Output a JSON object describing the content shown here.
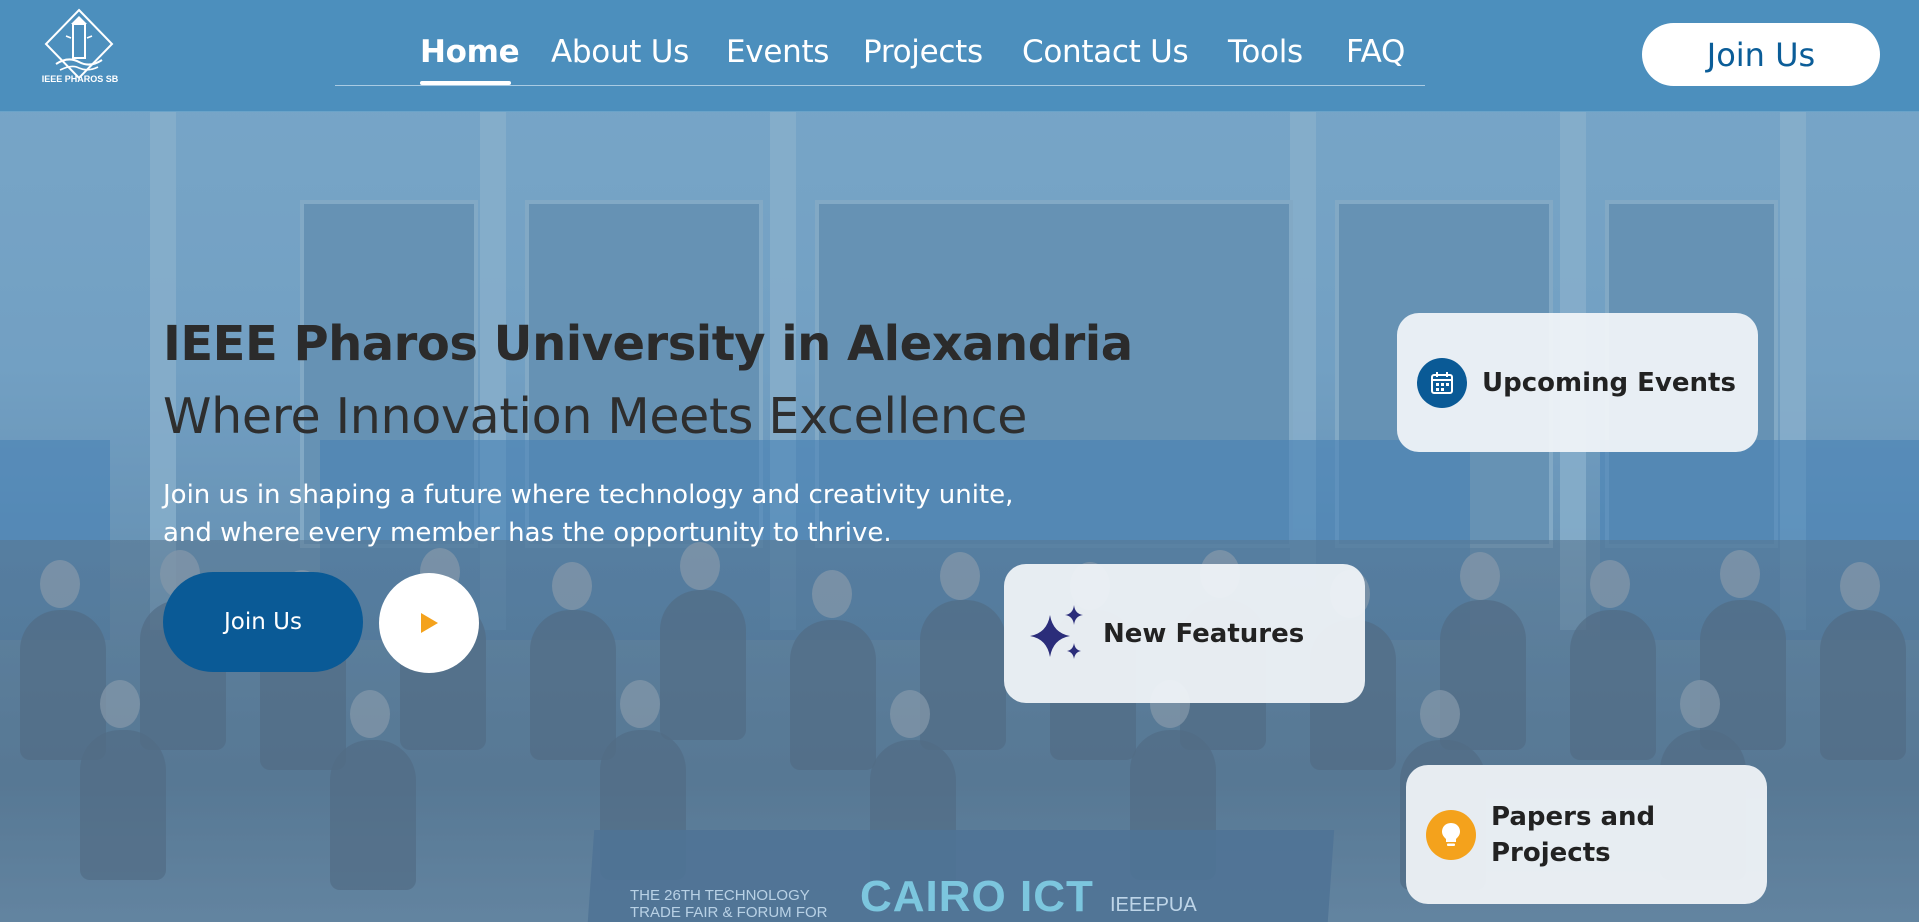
{
  "header": {
    "logo_text": "IEEE PHAROS SB",
    "nav": [
      {
        "label": "Home",
        "active": true
      },
      {
        "label": "About Us",
        "active": false
      },
      {
        "label": "Events",
        "active": false
      },
      {
        "label": "Projects",
        "active": false
      },
      {
        "label": "Contact Us",
        "active": false
      },
      {
        "label": "Tools",
        "active": false
      },
      {
        "label": "FAQ",
        "active": false
      }
    ],
    "join_label": "Join Us"
  },
  "hero": {
    "title": "IEEE Pharos University in Alexandria",
    "subtitle": "Where Innovation Meets Excellence",
    "description_line1": "Join us in shaping a future where technology and creativity unite,",
    "description_line2": "and where every member has the opportunity to thrive.",
    "join_label": "Join Us",
    "play_icon": "play-icon"
  },
  "cards": {
    "upcoming_events": {
      "label": "Upcoming Events",
      "icon": "calendar-icon"
    },
    "new_features": {
      "label": "New Features",
      "icon": "sparkles-icon"
    },
    "papers_projects": {
      "label_line1": "Papers and",
      "label_line2": "Projects",
      "icon": "lightbulb-icon"
    }
  },
  "background_photo_text": {
    "sign_left_line1": "THE 26TH TECHNOLOGY",
    "sign_left_line2": "TRADE FAIR & FORUM FOR",
    "sign_mid": "CAIRO ICT",
    "sign_right": "IEEEPUA"
  },
  "colors": {
    "header_bg": "#4c8fbd",
    "primary_blue": "#0a5a96",
    "accent_orange": "#f4a21c",
    "sparkle_navy": "#2b2d7a"
  }
}
